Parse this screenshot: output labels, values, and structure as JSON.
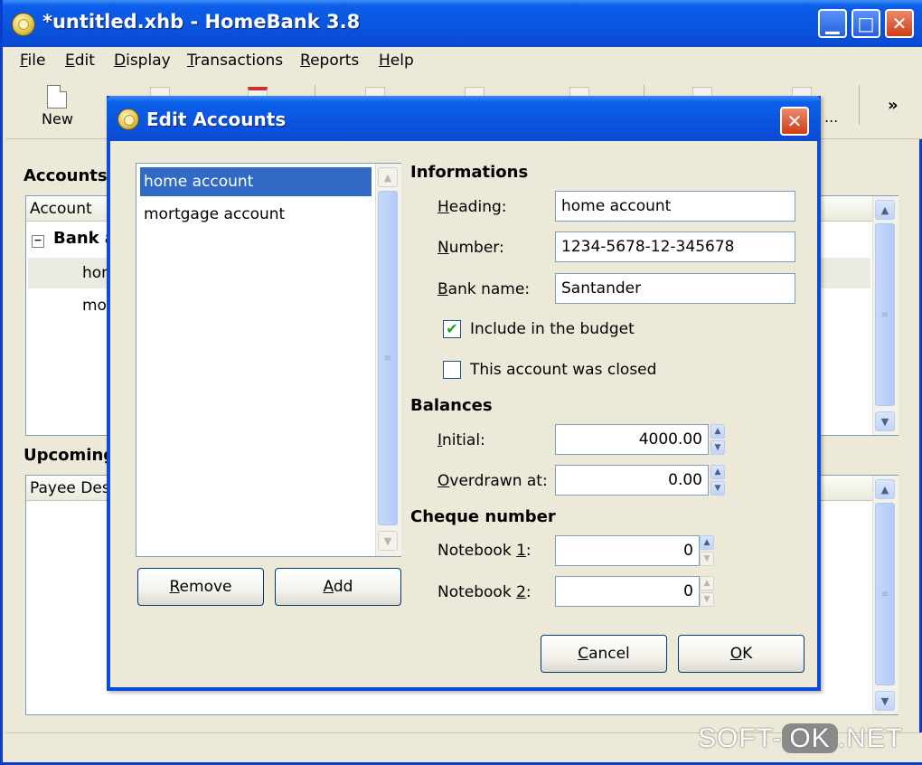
{
  "window": {
    "title": "*untitled.xhb - HomeBank 3.8"
  },
  "menu": [
    {
      "label": "File",
      "key": "F",
      "rest": "ile"
    },
    {
      "label": "Edit",
      "key": "E",
      "rest": "dit"
    },
    {
      "label": "Display",
      "key": "D",
      "rest": "isplay"
    },
    {
      "label": "Transactions",
      "key": "T",
      "rest": "ransactions"
    },
    {
      "label": "Reports",
      "key": "R",
      "rest": "eports"
    },
    {
      "label": "Help",
      "key": "H",
      "rest": "elp"
    }
  ],
  "toolbar": {
    "new_label": "New",
    "overflow": "»",
    "truncated": "..."
  },
  "accounts_panel": {
    "title": "Accounts",
    "col_account": "Account",
    "group": "Bank a",
    "rows": [
      "hom",
      "mor"
    ]
  },
  "upcoming_panel": {
    "title": "Upcoming",
    "col_payee": "Payee",
    "col_desc": "Des"
  },
  "dialog": {
    "title": "Edit Accounts",
    "accounts": [
      "home account",
      "mortgage account"
    ],
    "remove": {
      "key": "R",
      "rest": "emove"
    },
    "add": {
      "key": "A",
      "rest": "dd"
    },
    "informations": "Informations",
    "heading_label": {
      "key": "H",
      "rest": "eading:"
    },
    "heading_value": "home account",
    "number_label": {
      "key": "N",
      "rest": "umber:"
    },
    "number_value": "1234-5678-12-345678",
    "bank_label": {
      "key": "B",
      "rest": "ank name:"
    },
    "bank_value": "Santander",
    "include_budget": "Include in the budget",
    "include_budget_checked": true,
    "account_closed": "This account was closed",
    "account_closed_checked": false,
    "balances": "Balances",
    "initial_label": {
      "key": "I",
      "rest": "nitial:"
    },
    "initial_value": "4000.00",
    "overdrawn_label": {
      "key": "O",
      "rest": "verdrawn at:"
    },
    "overdrawn_value": "0.00",
    "cheque": "Cheque number",
    "notebook1_label": {
      "pre": "Notebook ",
      "key": "1",
      "rest": ":"
    },
    "notebook1_value": "0",
    "notebook2_label": {
      "pre": "Notebook ",
      "key": "2",
      "rest": ":"
    },
    "notebook2_value": "0",
    "cancel": {
      "key": "C",
      "rest": "ancel"
    },
    "ok": {
      "key": "O",
      "rest": "K"
    }
  },
  "watermark": {
    "left": "SOFT-",
    "mid": "OK",
    "right": ".NET"
  }
}
